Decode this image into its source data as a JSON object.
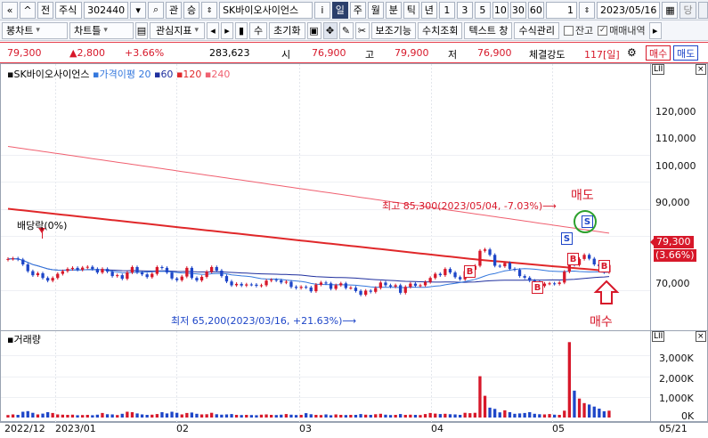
{
  "toolbar1": {
    "btn_prev": "«",
    "btn_up": "^",
    "btn_jeon": "전",
    "market": "주식",
    "code": "302440",
    "btn_gwan": "관",
    "btn_seung": "승",
    "stock_name": "SK바이오사이언스",
    "btn_i": "i",
    "periods": [
      "일",
      "주",
      "월",
      "분",
      "틱",
      "년"
    ],
    "selected_period": "일",
    "intervals": [
      "1",
      "3",
      "5",
      "10",
      "30",
      "60"
    ],
    "count_value": "1",
    "date_value": "2023/05/16",
    "btn_dang": "당"
  },
  "toolbar2": {
    "chart_type": "봉차트",
    "chart_tools": "차트틀",
    "watch_indicator": "관심지표",
    "btn_su": "수",
    "btn_reset": "초기화",
    "btn_aux": "보조기능",
    "btn_value_view": "수치조회",
    "btn_text_window": "텍스트 창",
    "btn_formula": "수식관리",
    "chk_balance": "잔고",
    "chk_trades": "매매내역"
  },
  "infobar": {
    "price": "79,300",
    "change": "▲2,800",
    "change_pct": "+3.66%",
    "volume": "283,623",
    "open_label": "시",
    "open": "76,900",
    "high_label": "고",
    "high": "79,900",
    "low_label": "저",
    "low": "76,900",
    "strength_label": "체결강도",
    "strength": "117[일]",
    "buy_btn": "매수",
    "sell_btn": "매도"
  },
  "chart_data": {
    "type": "candlestick",
    "title": "SK바이오사이언스",
    "legend": [
      {
        "name": "가격이평",
        "color": "#3377dd"
      },
      {
        "name": "20",
        "color": "#3377dd"
      },
      {
        "name": "60",
        "color": "#1f2f9e"
      },
      {
        "name": "120",
        "color": "#e0282a"
      },
      {
        "name": "240",
        "color": "#f06070"
      }
    ],
    "y_ticks": [
      "120,000",
      "110,000",
      "100,000",
      "90,000",
      "70,000"
    ],
    "ylim": [
      60000,
      130000
    ],
    "x_labels": [
      "2022/12",
      "2023/01",
      "02",
      "03",
      "04",
      "05",
      "05/21"
    ],
    "last_price_tag": "79,300",
    "last_pct_tag": "(3.66%)",
    "annotation_high": "최고 85,300(2023/05/04, -7.03%)⟶",
    "annotation_low": "최저 65,200(2023/03/16, +21.63%)⟶",
    "annotation_dividend": "배당락(0%)",
    "label_sell": "매도",
    "label_buy": "매수",
    "marker_sell": "S",
    "marker_buy": "B",
    "close": [
      81500,
      81700,
      81300,
      79500,
      77000,
      75500,
      76200,
      74500,
      73500,
      74500,
      76000,
      77000,
      77800,
      78200,
      77500,
      78300,
      78600,
      77800,
      76500,
      77800,
      76800,
      75200,
      75500,
      74200,
      76500,
      78500,
      76500,
      75800,
      74800,
      76000,
      78500,
      78200,
      76500,
      74300,
      73700,
      75000,
      78200,
      74500,
      73600,
      74900,
      76800,
      78500,
      77200,
      75200,
      73200,
      71800,
      72300,
      71700,
      72100,
      72000,
      71600,
      71800,
      73500,
      73800,
      73600,
      72800,
      73100,
      71200,
      70800,
      71200,
      71000,
      69600,
      72000,
      72800,
      72500,
      70500,
      71800,
      72500,
      70800,
      70900,
      69700,
      68300,
      69800,
      69400,
      70800,
      72800,
      71800,
      71300,
      71800,
      69000,
      71200,
      72400,
      71600,
      71800,
      73000,
      74500,
      76000,
      75500,
      77800,
      76500,
      74800,
      74000,
      77000,
      77500,
      79000,
      84500,
      85000,
      83000,
      79000,
      78800,
      80000,
      77800,
      77500,
      75200,
      74600,
      73500,
      73200,
      71500,
      72400,
      72500,
      72300,
      72800,
      76800,
      80500,
      79300,
      81500,
      83000,
      81600,
      79500,
      78800,
      76600,
      79300
    ],
    "volume_label": "거래량",
    "volume_ticks": [
      "3,000K",
      "2,000K",
      "1,000K",
      "0K"
    ],
    "volume": [
      120,
      150,
      130,
      280,
      310,
      230,
      150,
      190,
      260,
      220,
      150,
      140,
      130,
      140,
      110,
      120,
      130,
      110,
      140,
      220,
      160,
      150,
      120,
      180,
      280,
      260,
      200,
      150,
      130,
      140,
      170,
      260,
      200,
      280,
      230,
      150,
      220,
      240,
      180,
      150,
      160,
      230,
      160,
      140,
      150,
      170,
      130,
      120,
      130,
      120,
      110,
      140,
      150,
      130,
      120,
      140,
      170,
      140,
      120,
      130,
      210,
      160,
      130,
      120,
      150,
      110,
      150,
      130,
      120,
      130,
      130,
      170,
      140,
      130,
      160,
      180,
      140,
      120,
      130,
      170,
      130,
      140,
      130,
      120,
      170,
      220,
      190,
      170,
      180,
      160,
      150,
      130,
      230,
      210,
      230,
      2000,
      1050,
      480,
      420,
      250,
      350,
      260,
      180,
      200,
      220,
      260,
      180,
      160,
      150,
      170,
      140,
      130,
      330,
      3650,
      1300,
      920,
      700,
      630,
      530,
      430,
      300,
      330
    ]
  }
}
